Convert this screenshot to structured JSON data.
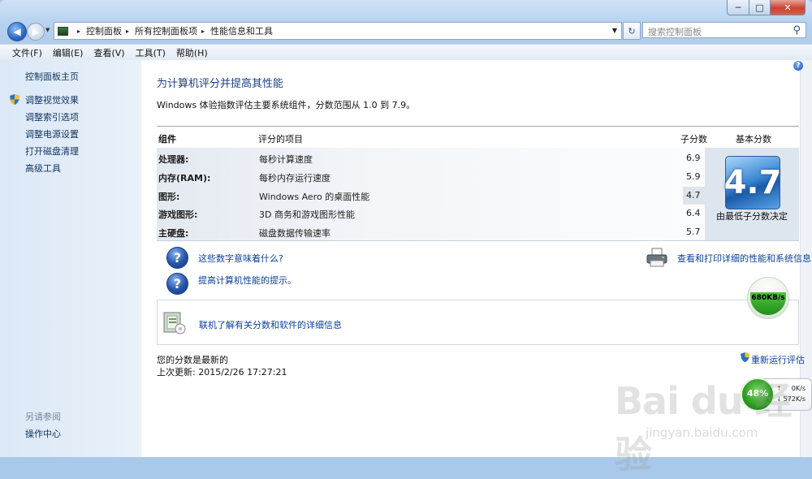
{
  "window": {
    "min": "─",
    "max": "□",
    "close": "✕"
  },
  "address": {
    "crumbs": [
      "控制面板",
      "所有控制面板项",
      "性能信息和工具"
    ],
    "sep": "▸",
    "drop": "▼"
  },
  "search": {
    "placeholder": "搜索控制面板",
    "icon": "search-icon"
  },
  "refresh": {
    "label": "↻"
  },
  "menu": [
    "文件(F)",
    "编辑(E)",
    "查看(V)",
    "工具(T)",
    "帮助(H)"
  ],
  "sidebar": {
    "home": "控制面板主页",
    "links": [
      "调整视觉效果",
      "调整索引选项",
      "调整电源设置",
      "打开磁盘清理",
      "高级工具"
    ],
    "see_also": "另请参阅",
    "action_center": "操作中心"
  },
  "main": {
    "title": "为计算机评分并提高其性能",
    "intro": "Windows 体验指数评估主要系统组件，分数范围从 1.0 到 7.9。",
    "headers": {
      "component": "组件",
      "item": "评分的项目",
      "subscore": "子分数",
      "base": "基本分数"
    },
    "rows": [
      {
        "component": "处理器:",
        "desc": "每秒计算速度",
        "score": "6.9"
      },
      {
        "component": "内存(RAM):",
        "desc": "每秒内存运行速度",
        "score": "5.9"
      },
      {
        "component": "图形:",
        "desc": "Windows Aero 的桌面性能",
        "score": "4.7"
      },
      {
        "component": "游戏图形:",
        "desc": "3D 商务和游戏图形性能",
        "score": "6.4"
      },
      {
        "component": "主硬盘:",
        "desc": "磁盘数据传输速率",
        "score": "5.7"
      }
    ],
    "base_score": "4.7",
    "base_caption": "由最低子分数决定",
    "link_meaning": "这些数字意味着什么?",
    "link_tips": "提高计算机性能的提示。",
    "link_print": "查看和打印详细的性能和系统信息",
    "link_online": "联机了解有关分数和软件的详细信息",
    "status_current": "您的分数是最新的",
    "last_update": "上次更新: 2015/2/26 17:27:21",
    "rerun": "重新运行评估"
  },
  "overlay": {
    "speed": "680KB/s",
    "cpu_pct": "48%",
    "up": "0K/s",
    "down": "572K/s",
    "arrow_up": "↑",
    "arrow_down": "↓"
  },
  "watermark": {
    "main": "Bai du 经验",
    "sub": "jingyan.baidu.com"
  },
  "colors": {
    "link": "#0b3f9a",
    "title": "#1c3f86",
    "accent": "#2a69c5"
  }
}
